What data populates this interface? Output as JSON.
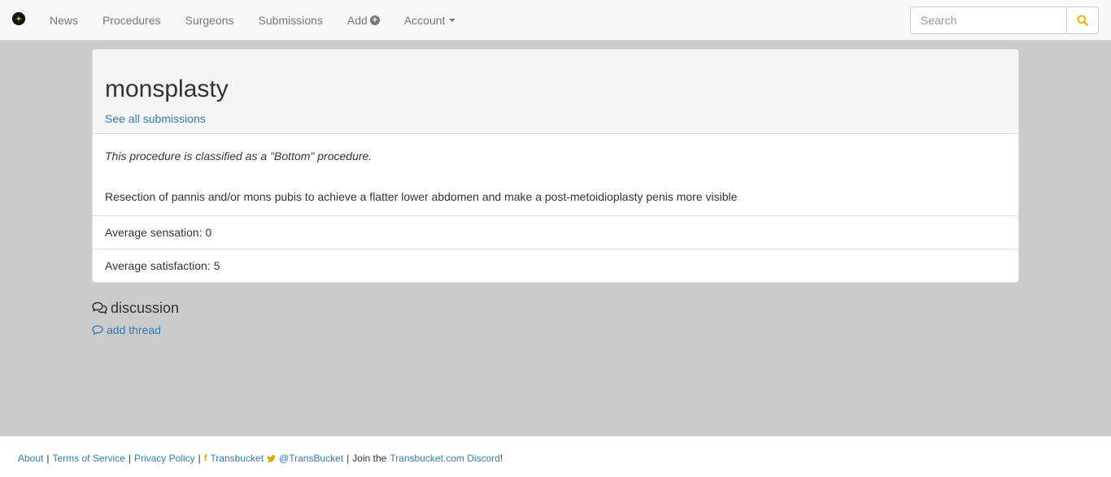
{
  "nav": {
    "items": [
      "News",
      "Procedures",
      "Surgeons",
      "Submissions"
    ],
    "add_label": "Add",
    "account_label": "Account",
    "search_placeholder": "Search"
  },
  "procedure": {
    "title": "monsplasty",
    "see_all": "See all submissions",
    "classification": "This procedure is classified as a \"Bottom\" procedure.",
    "description": "Resection of pannis and/or mons pubis to achieve a flatter lower abdomen and make a post-metoidioplasty penis more visible",
    "avg_sensation": "Average sensation: 0",
    "avg_satisfaction": "Average satisfaction: 5"
  },
  "discussion": {
    "heading": "discussion",
    "add_thread": "add thread"
  },
  "footer": {
    "about": "About",
    "terms": "Terms of Service",
    "privacy": "Privacy Policy",
    "facebook": "Transbucket",
    "twitter": "@TransBucket",
    "join_text": "Join the",
    "discord": "Transbucket.com Discord",
    "exclaim": "!"
  },
  "colors": {
    "link": "#337ab7",
    "accent": "#f0b400",
    "page_bg": "#cbcbcb"
  }
}
